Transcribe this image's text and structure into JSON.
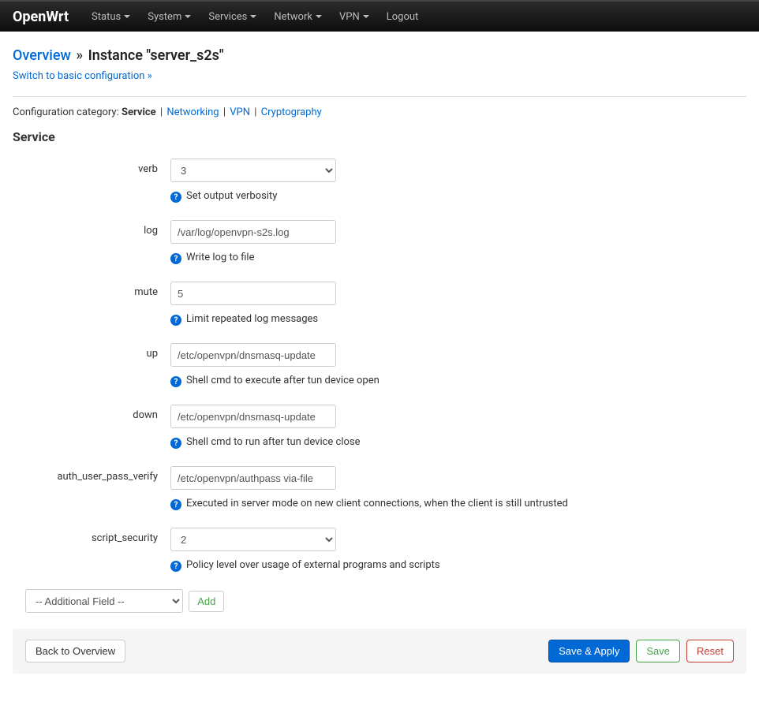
{
  "navbar": {
    "brand": "OpenWrt",
    "items": [
      {
        "label": "Status",
        "dropdown": true
      },
      {
        "label": "System",
        "dropdown": true
      },
      {
        "label": "Services",
        "dropdown": true
      },
      {
        "label": "Network",
        "dropdown": true
      },
      {
        "label": "VPN",
        "dropdown": true
      },
      {
        "label": "Logout",
        "dropdown": false
      }
    ]
  },
  "breadcrumb": {
    "overview": "Overview",
    "separator": "»",
    "instance": "Instance \"server_s2s\""
  },
  "switch_link": "Switch to basic configuration »",
  "config_nav": {
    "label": "Configuration category:",
    "active": "Service",
    "items": [
      "Networking",
      "VPN",
      "Cryptography"
    ]
  },
  "section_title": "Service",
  "fields": {
    "verb": {
      "label": "verb",
      "value": "3",
      "help": "Set output verbosity"
    },
    "log": {
      "label": "log",
      "value": "/var/log/openvpn-s2s.log",
      "help": "Write log to file"
    },
    "mute": {
      "label": "mute",
      "value": "5",
      "help": "Limit repeated log messages"
    },
    "up": {
      "label": "up",
      "value": "/etc/openvpn/dnsmasq-update",
      "help": "Shell cmd to execute after tun device open"
    },
    "down": {
      "label": "down",
      "value": "/etc/openvpn/dnsmasq-update",
      "help": "Shell cmd to run after tun device close"
    },
    "auth_user_pass_verify": {
      "label": "auth_user_pass_verify",
      "value": "/etc/openvpn/authpass via-file",
      "help": "Executed in server mode on new client connections, when the client is still untrusted"
    },
    "script_security": {
      "label": "script_security",
      "value": "2",
      "help": "Policy level over usage of external programs and scripts"
    }
  },
  "additional_field": {
    "placeholder": "-- Additional Field --",
    "add_label": "Add"
  },
  "actions": {
    "back": "Back to Overview",
    "save_apply": "Save & Apply",
    "save": "Save",
    "reset": "Reset"
  }
}
